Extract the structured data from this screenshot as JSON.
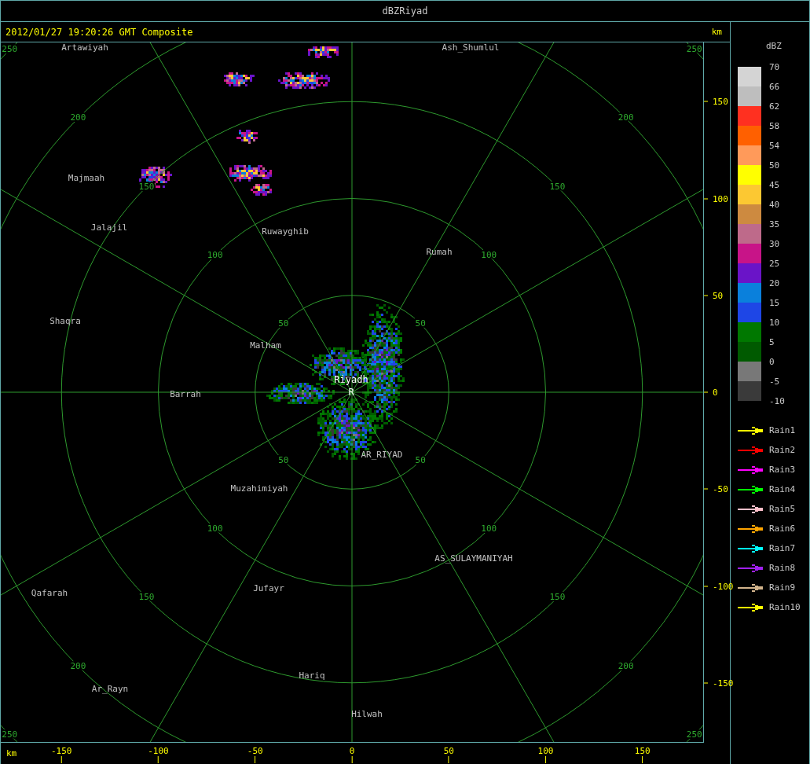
{
  "window": {
    "title": "dBZRiyad"
  },
  "header": {
    "timestamp": "2012/01/27 19:20:26 GMT Composite",
    "unit": "km"
  },
  "radar_map": {
    "range_rings": [
      {
        "labels": [
          "50",
          "50",
          "50",
          "50"
        ]
      },
      {
        "labels": [
          "100",
          "100",
          "100",
          "100"
        ]
      },
      {
        "labels": [
          "150",
          "150",
          "150",
          "150"
        ]
      },
      {
        "labels": [
          "200",
          "200",
          "200",
          "200"
        ]
      },
      {
        "labels": [
          "250",
          "250",
          "250",
          "250"
        ]
      }
    ],
    "places": [
      {
        "name": "Artawiyah",
        "kind": "town"
      },
      {
        "name": "Ash_Shumlul",
        "kind": "town"
      },
      {
        "name": "Majmaah",
        "kind": "town"
      },
      {
        "name": "Jalajil",
        "kind": "town"
      },
      {
        "name": "Ruwayghib",
        "kind": "town"
      },
      {
        "name": "Rumah",
        "kind": "town"
      },
      {
        "name": "Shaqra",
        "kind": "town"
      },
      {
        "name": "Malham",
        "kind": "town"
      },
      {
        "name": "Riyadh",
        "kind": "radar"
      },
      {
        "name": "R",
        "kind": "radar"
      },
      {
        "name": "Barrah",
        "kind": "town"
      },
      {
        "name": "AR_RIYAD",
        "kind": "town"
      },
      {
        "name": "Muzahimiyah",
        "kind": "town"
      },
      {
        "name": "AS_SULAYMANIYAH",
        "kind": "town"
      },
      {
        "name": "Qafarah",
        "kind": "town"
      },
      {
        "name": "Jufayr",
        "kind": "town"
      },
      {
        "name": "Hariq",
        "kind": "town"
      },
      {
        "name": "Ar_Rayn",
        "kind": "town"
      },
      {
        "name": "Hilwah",
        "kind": "town"
      }
    ]
  },
  "y_axis": {
    "ticks": [
      "150",
      "100",
      "50",
      "0",
      "-50",
      "-100",
      "-150"
    ]
  },
  "x_axis": {
    "unit": "km",
    "ticks": [
      "-150",
      "-100",
      "-50",
      "0",
      "50",
      "100",
      "150"
    ]
  },
  "legend": {
    "title": "dBZ",
    "bins": [
      {
        "color": "#d4d4d4"
      },
      {
        "color": "#bebebe"
      },
      {
        "color": "#ff3020"
      },
      {
        "color": "#ff6000"
      },
      {
        "color": "#ff9a5a"
      },
      {
        "color": "#ffff00"
      },
      {
        "color": "#fcc832"
      },
      {
        "color": "#cd8a40"
      },
      {
        "color": "#be6a8a"
      },
      {
        "color": "#c81488"
      },
      {
        "color": "#6a14c8"
      },
      {
        "color": "#0a80dc"
      },
      {
        "color": "#1e46e6"
      },
      {
        "color": "#007800"
      },
      {
        "color": "#005a00"
      },
      {
        "color": "#787878"
      },
      {
        "color": "#3a3a3a"
      }
    ],
    "labels": [
      "70",
      "66",
      "62",
      "58",
      "54",
      "50",
      "45",
      "40",
      "35",
      "30",
      "25",
      "20",
      "15",
      "10",
      "5",
      "0",
      "-5",
      "-10"
    ],
    "tracks": [
      {
        "label": "Rain1",
        "color": "#ffff00"
      },
      {
        "label": "Rain2",
        "color": "#ff0000"
      },
      {
        "label": "Rain3",
        "color": "#ff00ff"
      },
      {
        "label": "Rain4",
        "color": "#00ff00"
      },
      {
        "label": "Rain5",
        "color": "#ffc0cb"
      },
      {
        "label": "Rain6",
        "color": "#ffa500"
      },
      {
        "label": "Rain7",
        "color": "#00ffff"
      },
      {
        "label": "Rain8",
        "color": "#a020f0"
      },
      {
        "label": "Rain9",
        "color": "#d2b48c"
      },
      {
        "label": "Rain10",
        "color": "#ffff00"
      }
    ]
  }
}
